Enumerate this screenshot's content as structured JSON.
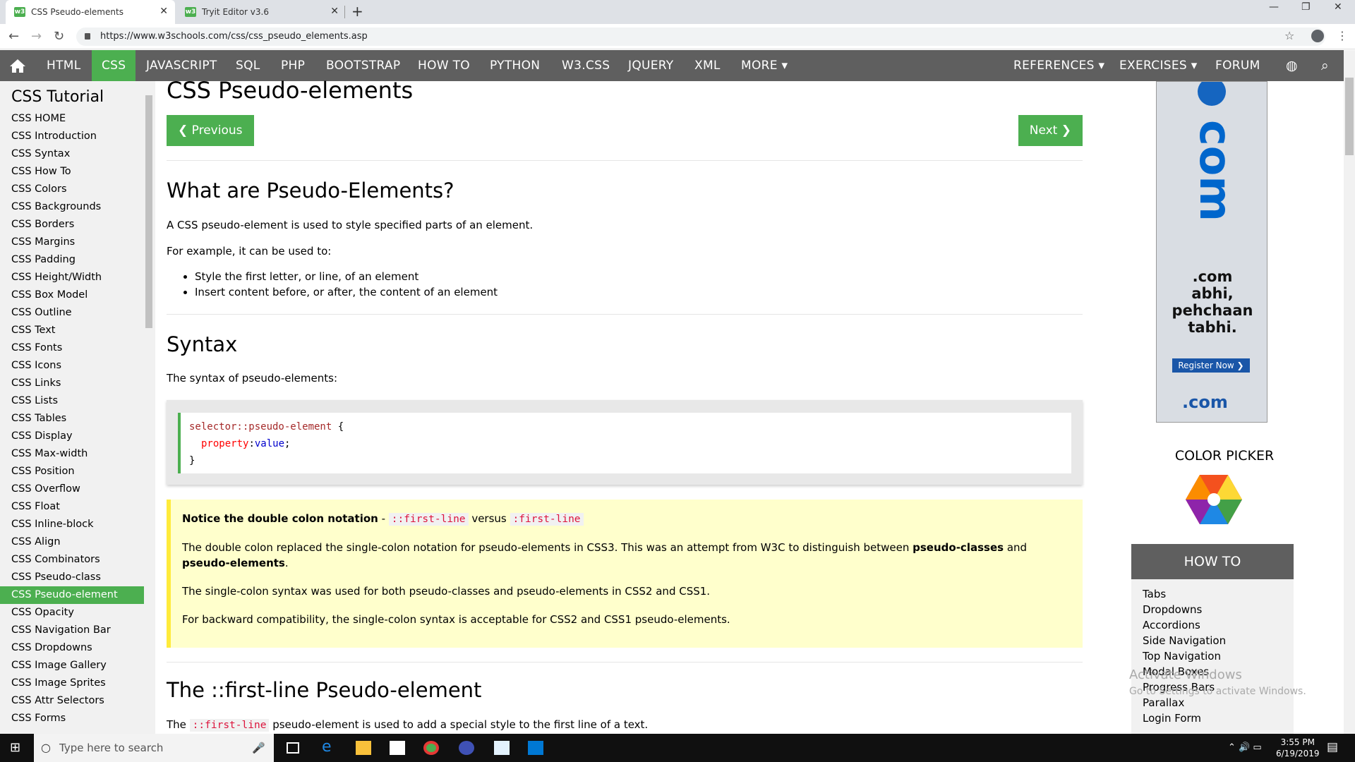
{
  "browser": {
    "tabs": [
      {
        "title": "CSS Pseudo-elements"
      },
      {
        "title": "Tryit Editor v3.6"
      }
    ],
    "url": "https://www.w3schools.com/css/css_pseudo_elements.asp"
  },
  "topnav": {
    "items": [
      "HTML",
      "CSS",
      "JAVASCRIPT",
      "SQL",
      "PHP",
      "BOOTSTRAP",
      "HOW TO",
      "PYTHON",
      "W3.CSS",
      "JQUERY",
      "XML",
      "MORE ▾"
    ],
    "right_items": [
      "REFERENCES ▾",
      "EXERCISES ▾",
      "FORUM"
    ],
    "active": "CSS"
  },
  "sidebar": {
    "title": "CSS Tutorial",
    "links": [
      "CSS HOME",
      "CSS Introduction",
      "CSS Syntax",
      "CSS How To",
      "CSS Colors",
      "CSS Backgrounds",
      "CSS Borders",
      "CSS Margins",
      "CSS Padding",
      "CSS Height/Width",
      "CSS Box Model",
      "CSS Outline",
      "CSS Text",
      "CSS Fonts",
      "CSS Icons",
      "CSS Links",
      "CSS Lists",
      "CSS Tables",
      "CSS Display",
      "CSS Max-width",
      "CSS Position",
      "CSS Overflow",
      "CSS Float",
      "CSS Inline-block",
      "CSS Align",
      "CSS Combinators",
      "CSS Pseudo-class",
      "CSS Pseudo-element",
      "CSS Opacity",
      "CSS Navigation Bar",
      "CSS Dropdowns",
      "CSS Image Gallery",
      "CSS Image Sprites",
      "CSS Attr Selectors",
      "CSS Forms"
    ],
    "active": "CSS Pseudo-element"
  },
  "main": {
    "title": "CSS Pseudo-elements",
    "prev_label": "❮ Previous",
    "next_label": "Next ❯",
    "section1_title": "What are Pseudo-Elements?",
    "section1_p1": "A CSS pseudo-element is used to style specified parts of an element.",
    "section1_p2": "For example, it can be used to:",
    "bullets": [
      "Style the first letter, or line, of an element",
      "Insert content before, or after, the content of an element"
    ],
    "syntax_title": "Syntax",
    "syntax_p": "The syntax of pseudo-elements:",
    "code": {
      "line1_sel": "selector::pseudo-element",
      "line1_brace": " {",
      "prop": "property",
      "val": "value",
      "close": "}"
    },
    "note": {
      "title": "Notice the double colon notation",
      "dash": " - ",
      "code1": "::first-line",
      "versus": " versus ",
      "code2": ":first-line",
      "p1_a": "The double colon replaced the single-colon notation for pseudo-elements in CSS3. This was an attempt from W3C to distinguish between ",
      "p1_b": "pseudo-classes",
      "p1_c": " and ",
      "p1_d": "pseudo-elements",
      "p1_e": ".",
      "p2": "The single-colon syntax was used for both pseudo-classes and pseudo-elements in CSS2 and CSS1.",
      "p3": "For backward compatibility, the single-colon syntax is acceptable for CSS2 and CSS1 pseudo-elements."
    },
    "section3_title": "The ::first-line Pseudo-element",
    "section3_p_a": "The ",
    "section3_code": "::first-line",
    "section3_p_b": " pseudo-element is used to add a special style to the first line of a text."
  },
  "ad": {
    "word": "com",
    "tag1": ".com",
    "tag2": "abhi,",
    "tag3": "pehchaan",
    "tag4": "tabhi.",
    "button": "Register Now",
    "logo": ".com"
  },
  "right": {
    "color_picker": "COLOR PICKER",
    "howto_title": "HOW TO",
    "howto_links": [
      "Tabs",
      "Dropdowns",
      "Accordions",
      "Side Navigation",
      "Top Navigation",
      "Modal Boxes",
      "Progress Bars",
      "Parallax",
      "Login Form"
    ]
  },
  "watermark": {
    "line1": "Activate Windows",
    "line2": "Go to Settings to activate Windows."
  },
  "taskbar": {
    "search_placeholder": "Type here to search",
    "time": "3:55 PM",
    "date": "6/19/2019"
  },
  "colors": {
    "accent": "#4caf50",
    "nav": "#5f5f5f",
    "note_bg": "#ffffcc",
    "note_border": "#ffeb3b",
    "code_red": "#a52a2a",
    "kw_red": "crimson"
  }
}
